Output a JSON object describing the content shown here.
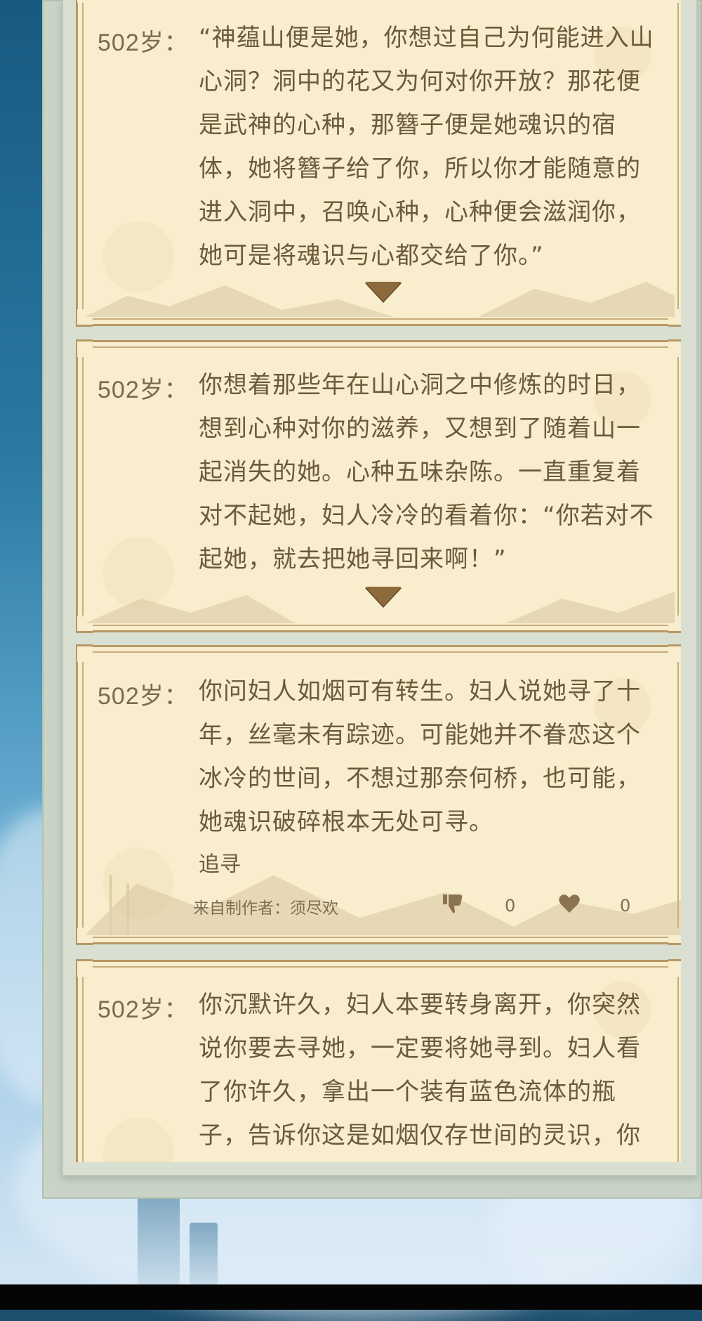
{
  "cards": [
    {
      "age": "502岁：",
      "text": "“神蕴山便是她，你想过自己为何能进入山心洞？洞中的花又为何对你开放？那花便是武神的心种，那簪子便是她魂识的宿体，她将簪子给了你，所以你才能随意的进入洞中，召唤心种，心种便会滋润你，她可是将魂识与心都交给了你。”"
    },
    {
      "age": "502岁：",
      "text": "你想着那些年在山心洞之中修炼的时日，想到心种对你的滋养，又想到了随着山一起消失的她。心种五味杂陈。一直重复着对不起她，妇人冷冷的看着你：“你若对不起她，就去把她寻回来啊！”"
    },
    {
      "age": "502岁：",
      "text": "你问妇人如烟可有转生。妇人说她寻了十年，丝毫未有踪迹。可能她并不眷恋这个冰冷的世间，不想过那奈何桥，也可能，她魂识破碎根本无处可寻。",
      "choice": "追寻",
      "author": "来自制作者：须尽欢",
      "dislike_count": "0",
      "like_count": "0"
    },
    {
      "age": "502岁：",
      "text": "你沉默许久，妇人本要转身离开，你突然说你要去寻她，一定要将她寻到。妇人看了你许久，拿出一个装有蓝色流体的瓶子，告诉你这是如烟仅存世间的灵识，你身上有她的气息，可以与这缕灵识共存，出"
    }
  ],
  "icons": {
    "expand": "triangle-down-icon",
    "dislike": "thumbs-down-icon",
    "like": "heart-icon"
  },
  "colors": {
    "card_bg": "#f8edcd",
    "card_border": "#b79866",
    "text": "#6b5a3c",
    "arrow": "#8c6a3c"
  }
}
